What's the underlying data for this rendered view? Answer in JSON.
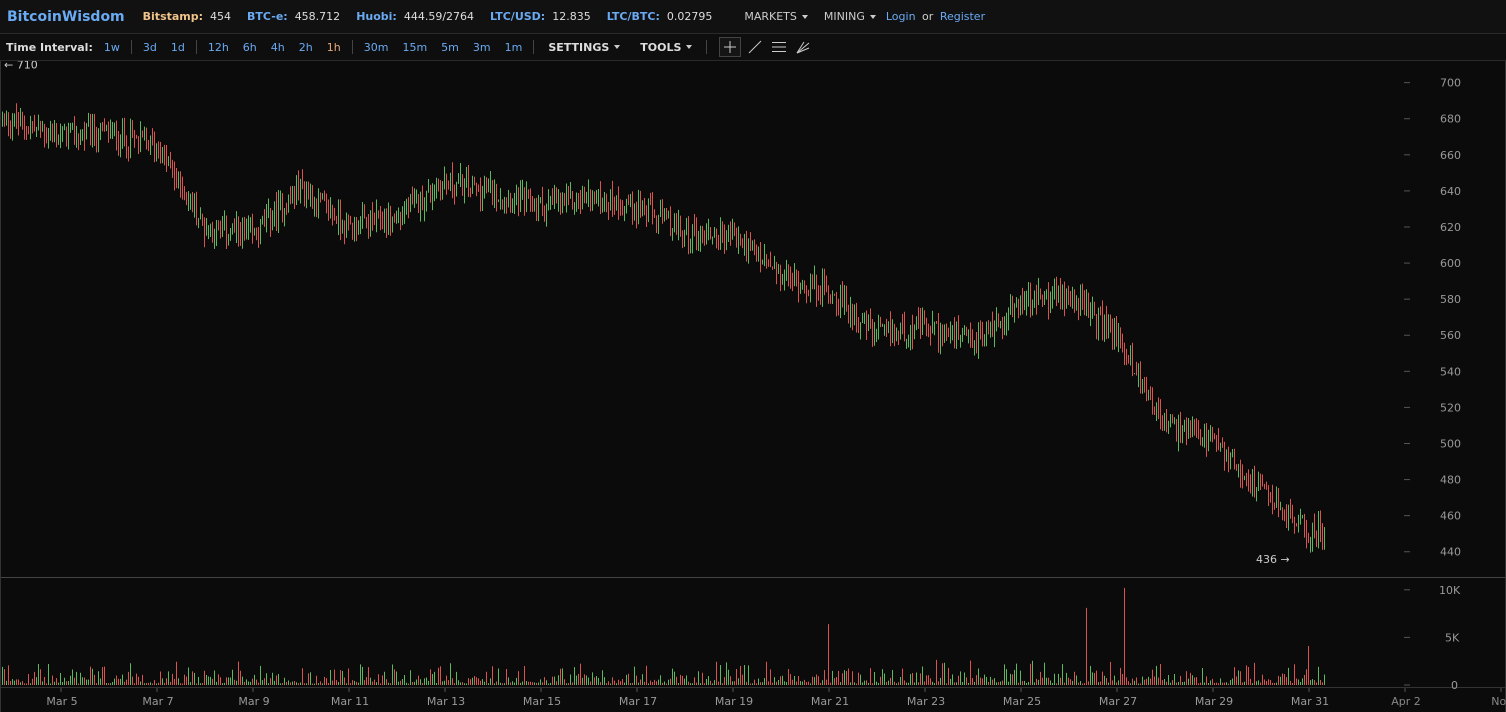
{
  "header": {
    "logo": "BitcoinWisdom",
    "tickers": [
      {
        "label": "Bitstamp:",
        "value": "454",
        "color": "#f0c38a"
      },
      {
        "label": "BTC-e:",
        "value": "458.712",
        "color": "#6aaaf3"
      },
      {
        "label": "Huobi:",
        "value": "444.59/2764",
        "color": "#6aaaf3"
      },
      {
        "label": "LTC/USD:",
        "value": "12.835",
        "color": "#6aaaf3"
      },
      {
        "label": "LTC/BTC:",
        "value": "0.02795",
        "color": "#6aaaf3"
      }
    ],
    "menus": [
      "MARKETS",
      "MINING"
    ],
    "login": "Login",
    "or": "or",
    "register": "Register"
  },
  "toolbar": {
    "label": "Time Interval:",
    "groups": [
      [
        "1w"
      ],
      [
        "3d",
        "1d"
      ],
      [
        "12h",
        "6h",
        "4h",
        "2h",
        "1h"
      ],
      [
        "30m",
        "15m",
        "5m",
        "3m",
        "1m"
      ]
    ],
    "active": "1h",
    "settings": "SETTINGS",
    "tools": "TOOLS",
    "tool_icons": [
      "crosshair-icon",
      "line-draw-icon",
      "horizontal-lines-icon",
      "fan-lines-icon"
    ]
  },
  "chart_data": {
    "type": "candlestick",
    "colors": {
      "up": "#5cb85c",
      "down": "#d9534f",
      "axis": "#999",
      "grid": "#2e2e2e"
    },
    "price_axis": {
      "ticks": [
        440,
        460,
        480,
        500,
        520,
        540,
        560,
        580,
        600,
        620,
        640,
        660,
        680,
        700
      ],
      "ylim": [
        426,
        712
      ]
    },
    "volume_axis": {
      "ticks": [
        {
          "v": 0,
          "label": "0"
        },
        {
          "v": 5000,
          "label": "5K"
        },
        {
          "v": 10000,
          "label": "10K"
        }
      ],
      "ylim": [
        0,
        10400
      ]
    },
    "x_labels": [
      "Mar 5",
      "Mar 7",
      "Mar 9",
      "Mar 11",
      "Mar 13",
      "Mar 15",
      "Mar 17",
      "Mar 19",
      "Mar 21",
      "Mar 23",
      "Mar 25",
      "Mar 27",
      "Mar 29",
      "Mar 31",
      "Apr 2",
      "Nov"
    ],
    "dim_x_labels": [
      "Apr 2",
      "Nov"
    ],
    "x_range": [
      "Mar 4 07:00",
      "Apr 2 12:00"
    ],
    "x_data": [
      "2014-03-04",
      "2014-03-31"
    ],
    "high_marker": {
      "value": 710,
      "label": "710",
      "arrow": "←"
    },
    "low_marker": {
      "value": 436,
      "label": "436",
      "arrow": "→"
    },
    "close_trend": [
      {
        "d": "2014-03-04",
        "c": 680
      },
      {
        "d": "2014-03-05",
        "c": 670
      },
      {
        "d": "2014-03-06",
        "c": 672
      },
      {
        "d": "2014-03-07",
        "c": 665
      },
      {
        "d": "2014-03-08",
        "c": 620
      },
      {
        "d": "2014-03-09",
        "c": 615
      },
      {
        "d": "2014-03-10",
        "c": 642
      },
      {
        "d": "2014-03-11",
        "c": 620
      },
      {
        "d": "2014-03-12",
        "c": 625
      },
      {
        "d": "2014-03-13",
        "c": 645
      },
      {
        "d": "2014-03-14",
        "c": 640
      },
      {
        "d": "2014-03-15",
        "c": 632
      },
      {
        "d": "2014-03-16",
        "c": 636
      },
      {
        "d": "2014-03-17",
        "c": 632
      },
      {
        "d": "2014-03-18",
        "c": 616
      },
      {
        "d": "2014-03-19",
        "c": 616
      },
      {
        "d": "2014-03-20",
        "c": 592
      },
      {
        "d": "2014-03-21",
        "c": 585
      },
      {
        "d": "2014-03-22",
        "c": 560
      },
      {
        "d": "2014-03-23",
        "c": 565
      },
      {
        "d": "2014-03-24",
        "c": 555
      },
      {
        "d": "2014-03-25",
        "c": 578
      },
      {
        "d": "2014-03-26",
        "c": 583
      },
      {
        "d": "2014-03-27",
        "c": 560
      },
      {
        "d": "2014-03-28",
        "c": 510
      },
      {
        "d": "2014-03-29",
        "c": 500
      },
      {
        "d": "2014-03-30",
        "c": 475
      },
      {
        "d": "2014-03-31",
        "c": 450
      },
      {
        "d": "2014-03-31",
        "c": 452
      }
    ],
    "volume_spikes": [
      {
        "d": "2014-03-27",
        "v": 10200
      },
      {
        "d": "2014-03-27",
        "v": 8100
      },
      {
        "d": "2014-03-21",
        "v": 6400
      },
      {
        "d": "2014-03-31",
        "v": 4100
      }
    ]
  }
}
